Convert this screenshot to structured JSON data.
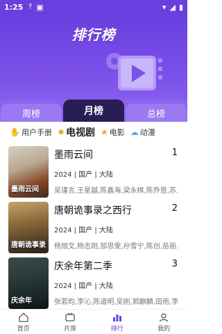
{
  "status": {
    "time": "1:25"
  },
  "header": {
    "title": "排行榜"
  },
  "tabs": [
    {
      "label": "周榜",
      "active": false
    },
    {
      "label": "月榜",
      "active": true
    },
    {
      "label": "总榜",
      "active": false
    }
  ],
  "categories": [
    {
      "label": "用户手册",
      "icon": "hand-icon"
    },
    {
      "label": "电视剧",
      "icon": "sun-icon",
      "active": true
    },
    {
      "label": "电影",
      "icon": "star-icon"
    },
    {
      "label": "动漫",
      "icon": "cloud-icon"
    }
  ],
  "items": [
    {
      "rank": "1",
      "title": "墨雨云间",
      "meta": "2024 | 国产 | 大陆",
      "cast": "吴谨言,王星越,陈鑫海,梁永棋,陈乔恩,苏...",
      "poster_text": "墨雨云间"
    },
    {
      "rank": "2",
      "title": "唐朝诡事录之西行",
      "meta": "2024 | 国产 | 大陆",
      "cast": "杨旭文,杨志刚,郜思雯,孙雪宁,陈创,岳丽...",
      "poster_text": "唐朝诡事录"
    },
    {
      "rank": "3",
      "title": "庆余年第二季",
      "meta": "2024 | 国产 | 大陆",
      "cast": "张若昀,李沁,陈道明,吴刚,郭麒麟,田雨,李...",
      "poster_text": "庆余年"
    }
  ],
  "nav": [
    {
      "label": "首页",
      "icon": "home-icon"
    },
    {
      "label": "片库",
      "icon": "tv-icon"
    },
    {
      "label": "排行",
      "icon": "ranking-icon",
      "active": true
    },
    {
      "label": "我的",
      "icon": "user-icon"
    }
  ]
}
